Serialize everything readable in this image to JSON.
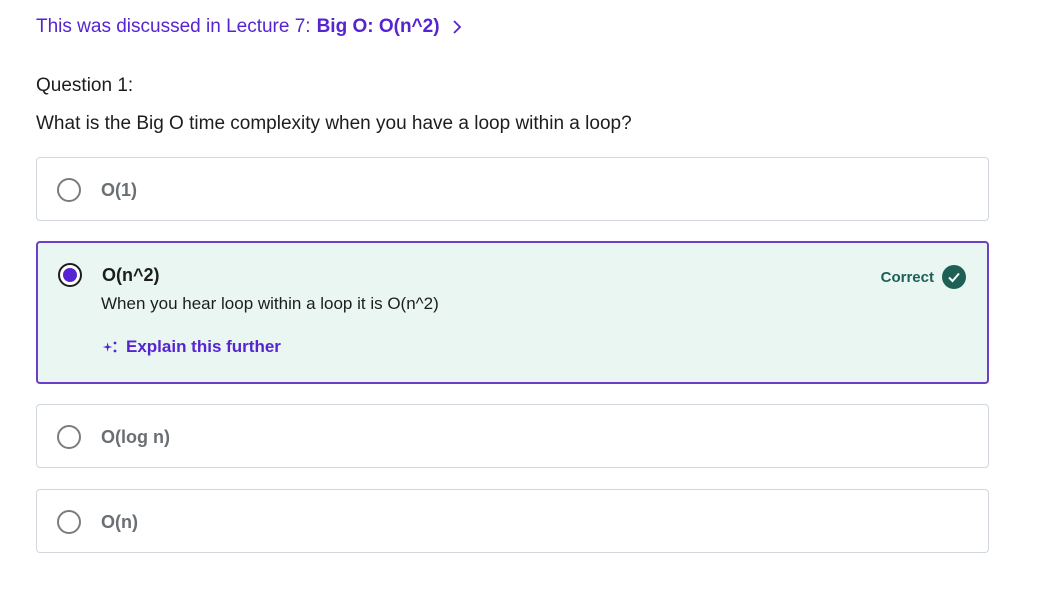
{
  "lecture_link": {
    "prefix": "This was discussed in Lecture 7:",
    "title": "Big O: O(n^2)",
    "chevron_icon": "chevron-right-icon"
  },
  "question": {
    "label": "Question 1:",
    "text": "What is the Big O time complexity when you have a loop within a loop?"
  },
  "options": [
    {
      "label": "O(1)",
      "selected": false
    },
    {
      "label": "O(n^2)",
      "selected": true,
      "status": "Correct",
      "explanation": "When you hear loop within a loop it is O(n^2)",
      "explain_button": "Explain this further"
    },
    {
      "label": "O(log n)",
      "selected": false
    },
    {
      "label": "O(n)",
      "selected": false
    }
  ],
  "colors": {
    "accent": "#5624d0",
    "correct": "#1e6055",
    "selected_background": "#eaf6f2",
    "selected_border": "#6b3fc7"
  }
}
